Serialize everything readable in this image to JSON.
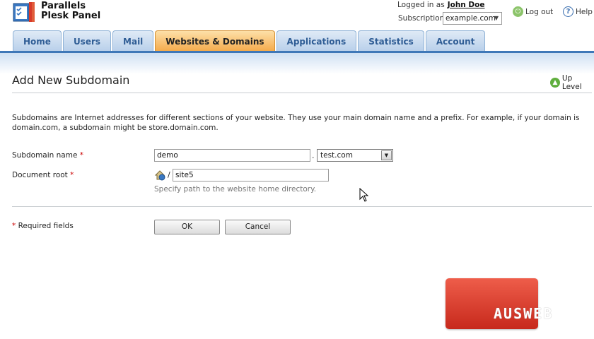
{
  "header": {
    "brand_line1": "Parallels",
    "brand_line2": "Plesk Panel",
    "logged_in_label": "Logged in as",
    "user_name": "John Doe",
    "subscription_label": "Subscription",
    "subscription_value": "example.com",
    "logout_label": "Log out",
    "help_label": "Help"
  },
  "tabs": [
    {
      "label": "Home",
      "active": false
    },
    {
      "label": "Users",
      "active": false
    },
    {
      "label": "Mail",
      "active": false
    },
    {
      "label": "Websites & Domains",
      "active": true
    },
    {
      "label": "Applications",
      "active": false
    },
    {
      "label": "Statistics",
      "active": false
    },
    {
      "label": "Account",
      "active": false
    }
  ],
  "page": {
    "title": "Add New Subdomain",
    "up_level": "Up Level",
    "description": "Subdomains are Internet addresses for different sections of your website. They use your main domain name and a prefix. For example, if your domain is domain.com, a subdomain might be store.domain.com."
  },
  "form": {
    "subdomain_label": "Subdomain name",
    "subdomain_value": "demo",
    "separator": ".",
    "domain_value": "test.com",
    "docroot_label": "Document root",
    "docroot_slash": "/",
    "docroot_value": "site5",
    "docroot_hint": "Specify path to the website home directory.",
    "required_marker": "*",
    "required_note": "Required fields",
    "ok_label": "OK",
    "cancel_label": "Cancel"
  },
  "watermark": {
    "text": "AUSWEB"
  },
  "colors": {
    "tab_active": "#f4a94a",
    "tab_inactive": "#b8cfea",
    "tab_bar": "#3f78b8",
    "required": "#cc0000",
    "watermark": "#d9372a"
  }
}
